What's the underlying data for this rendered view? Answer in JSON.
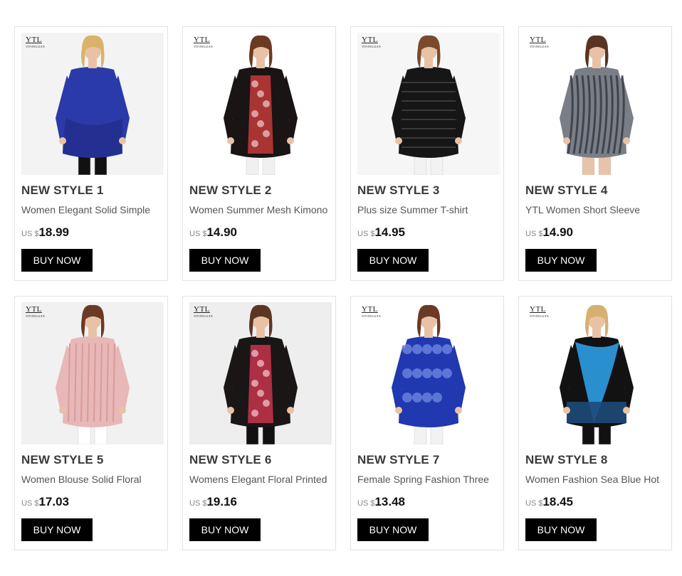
{
  "brand": {
    "logo_main": "YTL",
    "logo_sub": "YITONGLIAN"
  },
  "buy_label": "BUY NOW",
  "products": [
    {
      "title": "NEW STYLE 1",
      "description": "Women Elegant Solid Simple",
      "currency": "US $",
      "price": "18.99",
      "garment": "blue tunic",
      "garment_color": "#2a3aa8",
      "accent_color": "#1b267a",
      "legs_color": "#111111",
      "bg": "#f3f3f3"
    },
    {
      "title": "NEW STYLE 2",
      "description": "Women Summer Mesh Kimono",
      "currency": "US $",
      "price": "14.90",
      "garment": "floral kimono",
      "garment_color": "#1a1414",
      "accent_color": "#c23a3a",
      "legs_color": "#f0f0f0",
      "bg": "#ffffff"
    },
    {
      "title": "NEW STYLE 3",
      "description": "Plus size Summer T-shirt",
      "currency": "US $",
      "price": "14.95",
      "garment": "black lace top",
      "garment_color": "#161616",
      "accent_color": "#3a3a3a",
      "legs_color": "#f2f2f2",
      "bg": "#f6f6f6"
    },
    {
      "title": "NEW STYLE 4",
      "description": "YTL Women Short Sleeve",
      "currency": "US $",
      "price": "14.90",
      "garment": "printed dress",
      "garment_color": "#7a7e86",
      "accent_color": "#2a2c33",
      "legs_color": "#e8c3a8",
      "bg": "#ffffff"
    },
    {
      "title": "NEW STYLE 5",
      "description": "Women Blouse Solid Floral",
      "currency": "US $",
      "price": "17.03",
      "garment": "pink blouse",
      "garment_color": "#e8b7b7",
      "accent_color": "#d79a9a",
      "legs_color": "#ffffff",
      "bg": "#f1f1f1"
    },
    {
      "title": "NEW STYLE 6",
      "description": "Womens Elegant Floral Printed",
      "currency": "US $",
      "price": "19.16",
      "garment": "floral mesh top",
      "garment_color": "#1a1616",
      "accent_color": "#c8344c",
      "legs_color": "#111111",
      "bg": "#eeeeee"
    },
    {
      "title": "NEW STYLE 7",
      "description": "Female Spring Fashion Three",
      "currency": "US $",
      "price": "13.48",
      "garment": "blue paisley tunic",
      "garment_color": "#2038b0",
      "accent_color": "#6d86e0",
      "legs_color": "#f2f2f2",
      "bg": "#ffffff"
    },
    {
      "title": "NEW STYLE 8",
      "description": "Women Fashion Sea Blue Hot",
      "currency": "US $",
      "price": "18.45",
      "garment": "black sea blue print tunic",
      "garment_color": "#121212",
      "accent_color": "#2a8fcf",
      "legs_color": "#111111",
      "bg": "#ffffff"
    }
  ]
}
